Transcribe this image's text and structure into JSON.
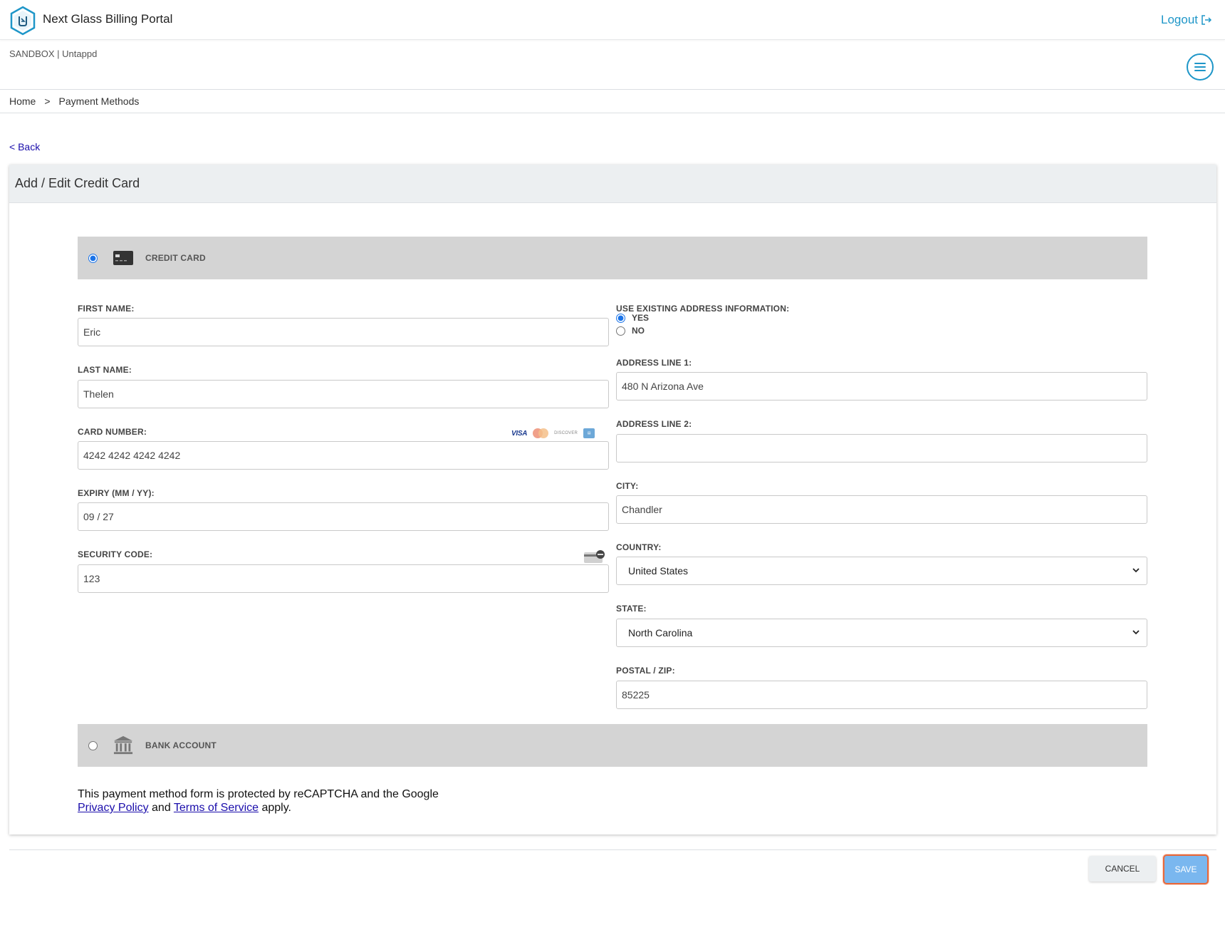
{
  "header": {
    "app_title": "Next Glass Billing Portal",
    "logout_label": "Logout",
    "accent_color": "#1e96c8"
  },
  "subheader": {
    "env_label": "SANDBOX | Untappd"
  },
  "breadcrumb": {
    "home": "Home",
    "separator": ">",
    "current": "Payment Methods"
  },
  "back_label": "< Back",
  "card": {
    "title": "Add / Edit Credit Card",
    "credit_card": {
      "label": "CREDIT CARD",
      "selected": true,
      "icon": "credit-card-icon"
    },
    "bank_account": {
      "label": "BANK ACCOUNT",
      "selected": false,
      "icon": "bank-icon"
    },
    "left_fields": {
      "first_name": {
        "label": "FIRST NAME:",
        "value": "Eric"
      },
      "last_name": {
        "label": "LAST NAME:",
        "value": "Thelen"
      },
      "card_number": {
        "label": "CARD NUMBER:",
        "value": "4242 4242 4242 4242"
      },
      "expiry": {
        "label": "EXPIRY (MM / YY):",
        "value": "09 / 27"
      },
      "security_code": {
        "label": "SECURITY CODE:",
        "value": "123"
      }
    },
    "card_brands": {
      "visa": "VISA",
      "discover": "DISCOVER"
    },
    "right_fields": {
      "use_existing": {
        "label": "USE EXISTING ADDRESS INFORMATION:",
        "yes": "YES",
        "no": "NO",
        "selected": "yes"
      },
      "address1": {
        "label": "ADDRESS LINE 1:",
        "value": "480 N Arizona Ave"
      },
      "address2": {
        "label": "ADDRESS LINE 2:",
        "value": ""
      },
      "city": {
        "label": "CITY:",
        "value": "Chandler"
      },
      "country": {
        "label": "COUNTRY:",
        "value": "United States"
      },
      "state": {
        "label": "STATE:",
        "value": "North Carolina"
      },
      "postal": {
        "label": "POSTAL / ZIP:",
        "value": "85225"
      }
    },
    "recaptcha": {
      "line1": "This payment method form is protected by reCAPTCHA and the Google",
      "privacy": "Privacy Policy",
      "and": "and",
      "terms": "Terms of Service",
      "apply": "apply."
    }
  },
  "actions": {
    "cancel": "CANCEL",
    "save": "SAVE"
  }
}
